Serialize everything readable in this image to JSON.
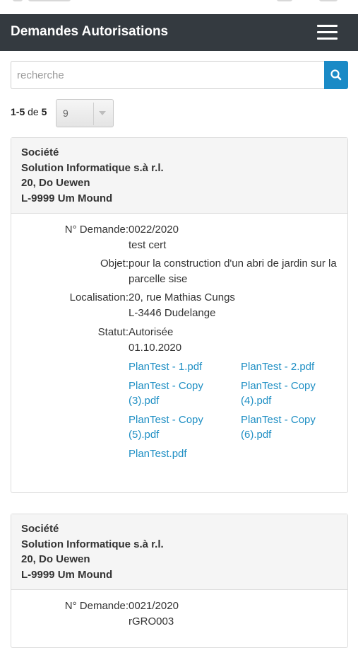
{
  "app": {
    "title": "Demandes Autorisations"
  },
  "search": {
    "placeholder": "recherche"
  },
  "pagination": {
    "range": "1-5",
    "of_label": "de",
    "total": "5",
    "page_size": "9"
  },
  "requests": [
    {
      "company_heading": "Société",
      "company_name": "Solution Informatique s.à r.l.",
      "company_street": "20, Do Uewen",
      "company_city": "L-9999 Um Mound",
      "labels": {
        "number": "N° Demande:",
        "object": "Objet:",
        "location": "Localisation:",
        "status": "Statut:"
      },
      "number": "0022/2020",
      "reference": "test cert",
      "object": "pour la construction d'un abri de jardin sur la parcelle sise",
      "location_street": "20, rue Mathias Cungs",
      "location_city": "L-3446 Dudelange",
      "status": "Autorisée",
      "status_date": "01.10.2020",
      "files": [
        "PlanTest - 1.pdf",
        "PlanTest - 2.pdf",
        "PlanTest - Copy (3).pdf",
        "PlanTest - Copy (4).pdf",
        "PlanTest - Copy (5).pdf",
        "PlanTest - Copy (6).pdf",
        "PlanTest.pdf"
      ]
    },
    {
      "company_heading": "Société",
      "company_name": "Solution Informatique s.à r.l.",
      "company_street": "20, Do Uewen",
      "company_city": "L-9999 Um Mound",
      "labels": {
        "number": "N° Demande:"
      },
      "number": "0021/2020",
      "reference": "rGRO003"
    }
  ],
  "colors": {
    "navbar": "#343a40",
    "accent": "#1a8ac6",
    "link": "#1f8fc4",
    "card_header": "#f5f5f5"
  },
  "icons": {
    "menu": "hamburger-icon",
    "search": "search-icon",
    "dropdown": "chevron-down-icon"
  }
}
